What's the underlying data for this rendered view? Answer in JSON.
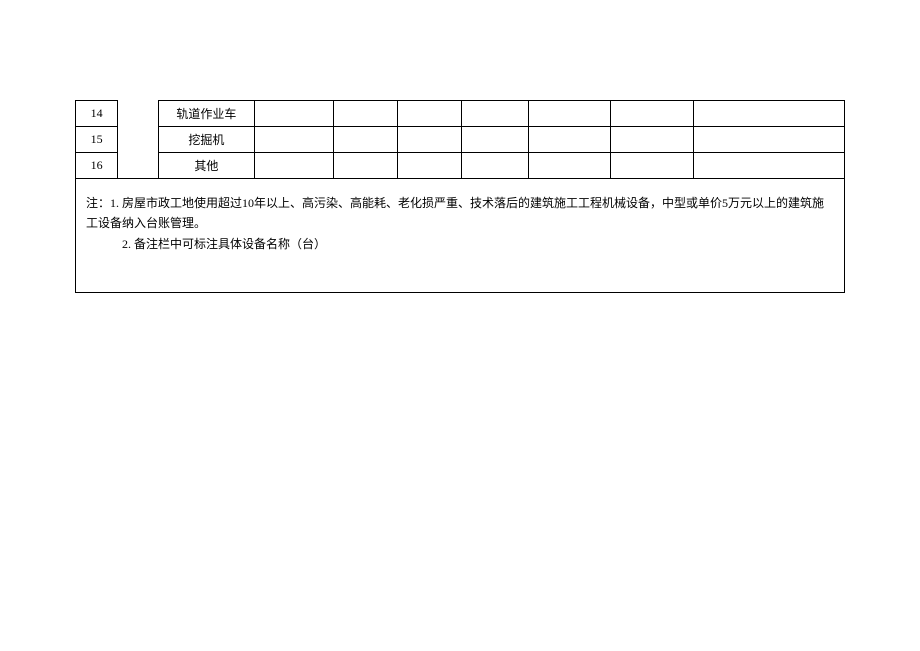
{
  "table": {
    "rows": [
      {
        "idx": "14",
        "name": "轨道作业车"
      },
      {
        "idx": "15",
        "name": "挖掘机"
      },
      {
        "idx": "16",
        "name": "其他"
      }
    ]
  },
  "notes": {
    "line1_prefix": "注：",
    "line1_num": "1.",
    "line1_text": "房屋市政工地使用超过10年以上、高污染、高能耗、老化损严重、技术落后的建筑施工工程机械设备，中型或单价5万元以上的建筑施工设备纳入台账管理。",
    "line2_num": "2.",
    "line2_text": "备注栏中可标注具体设备名称（台）"
  }
}
